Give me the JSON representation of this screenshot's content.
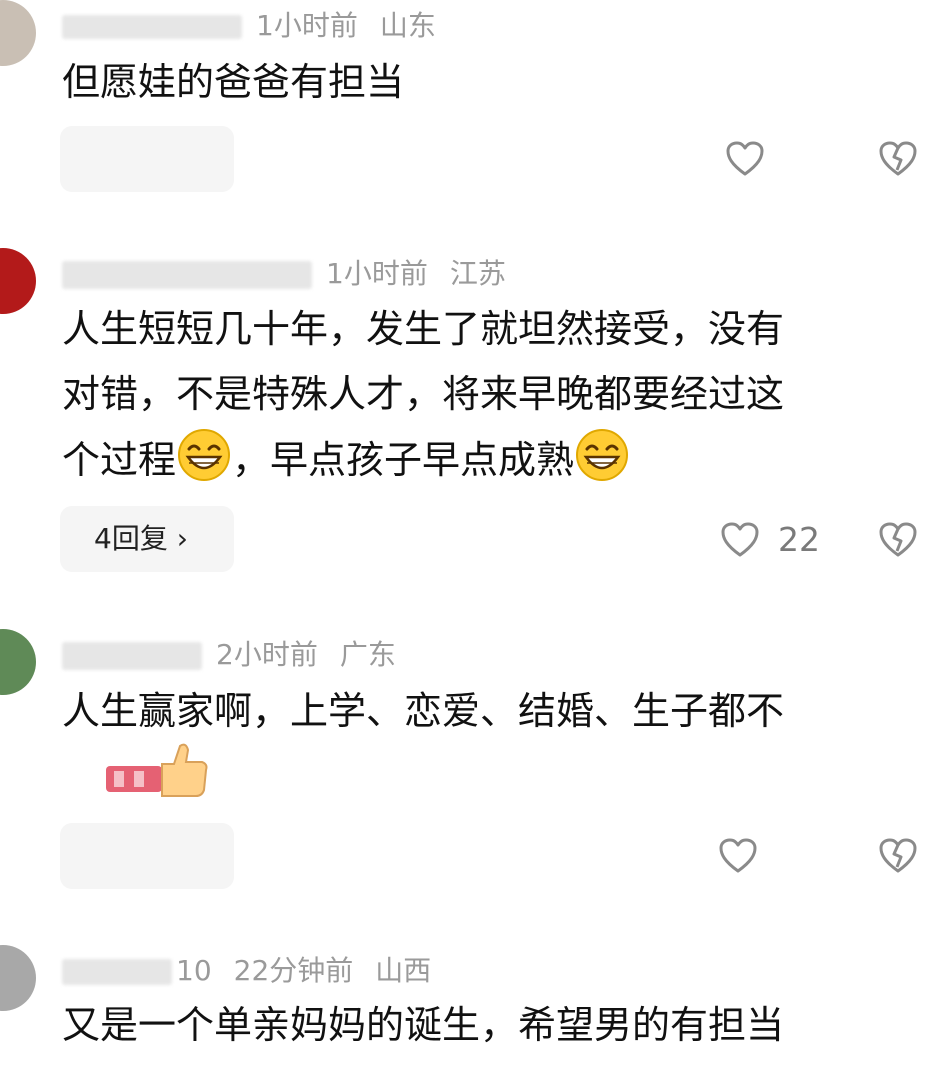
{
  "comments": [
    {
      "time": "1小时前",
      "region": "山东",
      "text_lines": [
        "但愿娃的爸爸有担当"
      ],
      "reply_label": "",
      "likes": ""
    },
    {
      "time": "1小时前",
      "region": "江苏",
      "text_lines": [
        "人生短短几十年，发生了就坦然接受，没有",
        "对错，不是特殊人才，将来早晚都要经过这",
        "个过程",
        "，早点孩子早点成熟"
      ],
      "reply_label": "4回复 ›",
      "likes": "22"
    },
    {
      "time": "2小时前",
      "region": "广东",
      "text_lines": [
        "人生赢家啊，上学、恋爱、结婚、生子都不"
      ],
      "reply_label": "",
      "likes": ""
    },
    {
      "time": "22分钟前",
      "region": "山西",
      "name_fragment": "10",
      "text_lines": [
        "又是一个单亲妈妈的诞生，希望男的有担当"
      ],
      "reply_label": "",
      "likes": ""
    }
  ],
  "icons": {
    "like": "heart-outline-icon",
    "dislike": "broken-heart-icon",
    "emoji": "grinning-face-icon",
    "thumbs": "thumbs-up-icon"
  },
  "colors": {
    "text": "#111111",
    "meta": "#9a9a9a",
    "pill": "#f5f5f5",
    "icon": "#8a8a8a"
  }
}
